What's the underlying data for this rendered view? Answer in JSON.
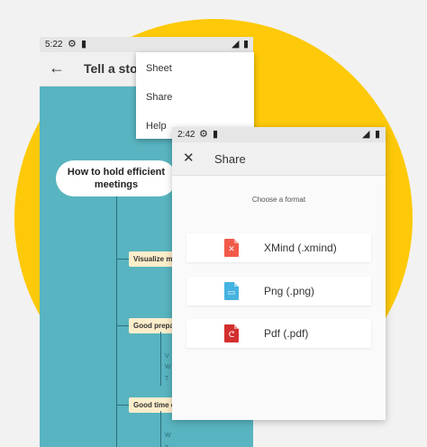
{
  "colors": {
    "background": "#f2f2f2",
    "accent_circle": "#fdc908",
    "mindmap_bg": "#58b4c0",
    "node_bg": "#fdeecb",
    "xmind_icon": "#f15a4a",
    "png_icon": "#45b3e0",
    "pdf_icon": "#d32f2f"
  },
  "back_phone": {
    "status_time": "5:22",
    "title": "Tell a stor",
    "back_icon": "arrow-left-icon",
    "menu": {
      "items": [
        "Sheet",
        "Share",
        "Help"
      ]
    },
    "mindmap": {
      "root": "How to hold efficient meetings",
      "branches": [
        "Visualize me",
        "Good prepar",
        "Good time c"
      ],
      "sub_marks": [
        "V",
        "W",
        "T",
        "W",
        "T"
      ]
    }
  },
  "front_phone": {
    "status_time": "2:42",
    "title": "Share",
    "close_icon": "close-icon",
    "subtitle": "Choose a format",
    "formats": [
      {
        "label": "XMind (.xmind)",
        "icon": "xmind-file-icon"
      },
      {
        "label": "Png (.png)",
        "icon": "png-file-icon"
      },
      {
        "label": "Pdf (.pdf)",
        "icon": "pdf-file-icon"
      }
    ]
  }
}
